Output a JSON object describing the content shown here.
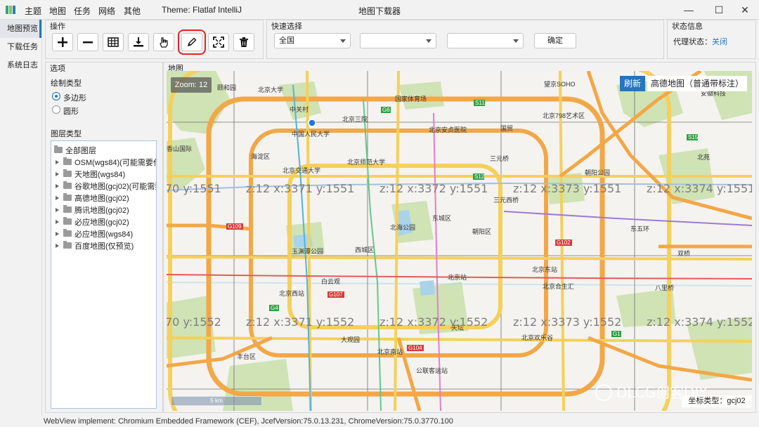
{
  "menu": {
    "items": [
      "主题",
      "地图",
      "任务",
      "网络",
      "其他"
    ],
    "theme": "Theme: Flatlaf IntelliJ"
  },
  "window": {
    "title": "地图下载器",
    "minimize": "—",
    "maximize": "☐",
    "close": "✕"
  },
  "sidenav": {
    "items": [
      "地图预览",
      "下载任务",
      "系统日志"
    ]
  },
  "toolbar": {
    "title": "操作"
  },
  "quick_select": {
    "title": "快速选择",
    "region": "全国",
    "province": "",
    "city": "",
    "confirm": "确定"
  },
  "status_info": {
    "title": "状态信息",
    "proxy_label": "代理状态：",
    "proxy_value": "关闭"
  },
  "options": {
    "title": "选项",
    "draw_type_label": "绘制类型",
    "draw_types": [
      "多边形",
      "圆形"
    ],
    "layer_type_label": "图层类型",
    "layers": [
      "全部图层",
      "OSM(wgs84)(可能需要代",
      "天地图(wgs84)",
      "谷歌地图(gcj02)(可能需要",
      "高德地图(gcj02)",
      "腾讯地图(gcj02)",
      "必应地图(gcj02)",
      "必应地图(wgs84)",
      "百度地图(仅预览)"
    ]
  },
  "map": {
    "title": "地图",
    "zoom": "Zoom: 12",
    "refresh": "刷新",
    "provider": "高德地图（普通带标注）",
    "scale": "5 km",
    "coord_type": "坐标类型：gcj02",
    "watermark": "DLCG创客DIY",
    "tiles_row1": [
      "70 y:1551",
      "z:12 x:3371 y:1551",
      "z:12 x:3372 y:1551",
      "z:12 x:3373 y:1551",
      "z:12 x:3374 y:1551"
    ],
    "tiles_row2": [
      "70 y:1552",
      "z:12 x:3371 y:1552",
      "z:12 x:3372 y:1552",
      "z:12 x:3373 y:1552",
      "z:12 x:3374 y:1552"
    ],
    "places": [
      "颐和园",
      "北京大学",
      "中关村",
      "北京三院",
      "国家体育场",
      "望京SOHO",
      "中国人民大学",
      "北京安贞医院",
      "北京798艺术区",
      "安徽科技",
      "香山国际",
      "北京师范大学",
      "北京交通大学",
      "三元桥",
      "朝阳公园",
      "海淀区",
      "北海公园",
      "东城区",
      "朝阳区",
      "西城区",
      "北京站",
      "北京东站",
      "北京西站",
      "白云观",
      "北京合生汇",
      "八里桥",
      "玉渊潭公园",
      "天坛",
      "北京南站",
      "大观园",
      "丰台区",
      "公联客运站",
      "北京欢乐谷",
      "双桥",
      "东五环",
      "三元西桥",
      "北苑",
      "国贸"
    ],
    "road_labels": [
      "G6",
      "S11",
      "S12",
      "G109",
      "G102",
      "G107",
      "G4",
      "G104",
      "G1",
      "S15"
    ]
  },
  "status_bar": {
    "text": "WebView implement: Chromium Embedded Framework (CEF), JcefVersion:75.0.13.231, ChromeVersion:75.0.3770.100"
  },
  "colors": {
    "accent": "#2675bf",
    "highlight": "#e0242a",
    "road_orange": "#f3a746",
    "road_yellow": "#f5d05a",
    "park": "#cfe3b5",
    "water": "#aad3ea"
  }
}
